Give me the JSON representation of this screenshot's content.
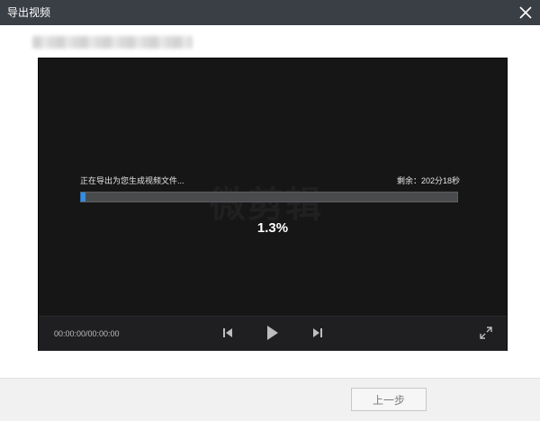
{
  "window": {
    "title": "导出视频"
  },
  "export": {
    "status_text": "正在导出为您生成视频文件...",
    "remaining_text": "剩余：202分18秒",
    "percent_text": "1.3%",
    "progress": 0.013
  },
  "player": {
    "timecode": "00:00:00/00:00:00",
    "watermark": "微剪辑"
  },
  "footer": {
    "prev_label": "上一步"
  },
  "colors": {
    "titlebar": "#3a3f46",
    "progress_fill": "#2a8ef0",
    "player_bg": "#161616"
  },
  "icons": [
    "close-icon",
    "skip-back-icon",
    "play-icon",
    "skip-forward-icon",
    "fullscreen-icon"
  ]
}
